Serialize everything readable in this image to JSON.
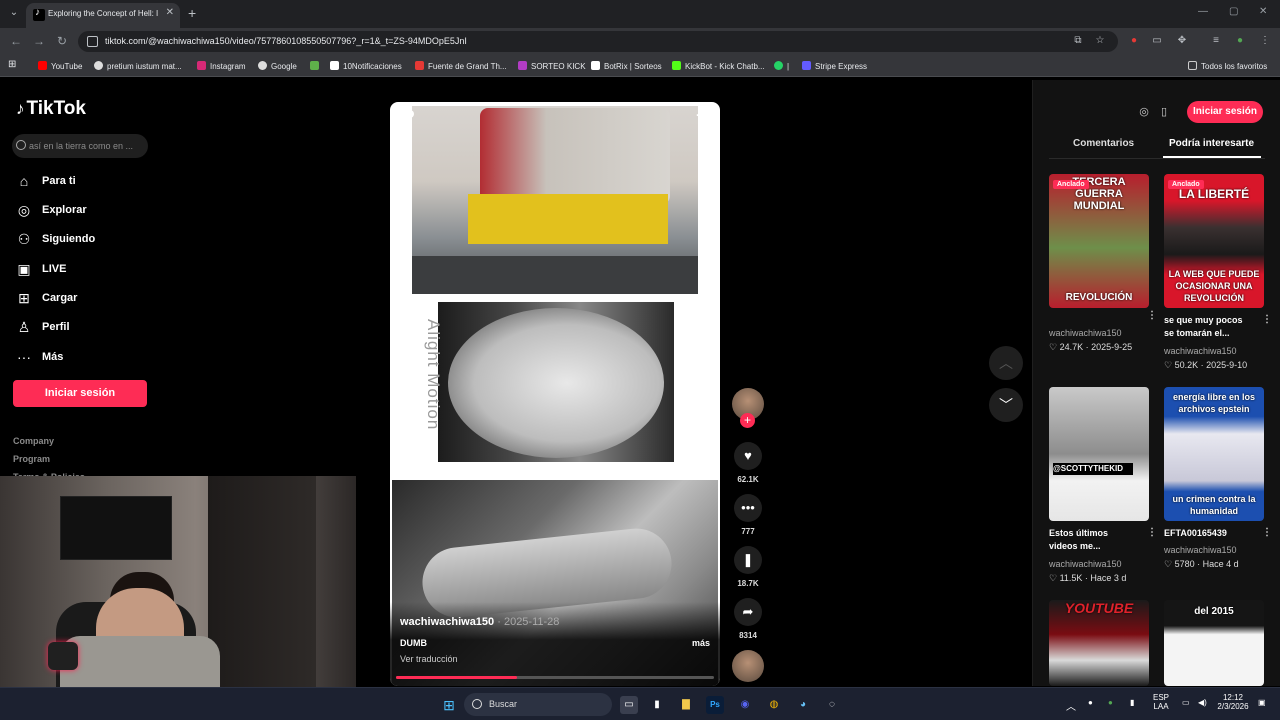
{
  "browser": {
    "tab_title": "Exploring the Concept of Hell: I",
    "url": "tiktok.com/@wachiwachiwa150/video/7577860108550507796?_r=1&_t=ZS-94MDOpE5JnI",
    "bookmarks": [
      {
        "label": "YouTube",
        "color": "#ff0000"
      },
      {
        "label": "pretium iustum mat...",
        "color": "#dddddd"
      },
      {
        "label": "Instagram",
        "color": "#d62976"
      },
      {
        "label": "Google",
        "color": "#dddddd"
      },
      {
        "label": "",
        "color": "#5fb04a"
      },
      {
        "label": "10Notificaciones",
        "color": "#ffffff"
      },
      {
        "label": "Fuente de Grand Th...",
        "color": "#e53935"
      },
      {
        "label": "SORTEO KICK",
        "color": "#b23cc4"
      },
      {
        "label": "BotRix | Sorteos",
        "color": "#ffffff"
      },
      {
        "label": "KickBot - Kick Chatb...",
        "color": "#53fc18"
      },
      {
        "label": "|",
        "color": "#25d366"
      },
      {
        "label": "Stripe Express",
        "color": "#635bff"
      }
    ],
    "all_favorites": "Todos los favoritos"
  },
  "sidebar": {
    "logo": "TikTok",
    "search_placeholder": "así en la tierra como en ...",
    "nav": [
      {
        "label": "Para ti",
        "icon": "home-icon"
      },
      {
        "label": "Explorar",
        "icon": "compass-icon"
      },
      {
        "label": "Siguiendo",
        "icon": "following-icon"
      },
      {
        "label": "LIVE",
        "icon": "live-icon"
      },
      {
        "label": "Cargar",
        "icon": "upload-icon"
      },
      {
        "label": "Perfil",
        "icon": "profile-icon"
      },
      {
        "label": "Más",
        "icon": "more-icon"
      }
    ],
    "login": "Iniciar sesión",
    "footer": [
      "Company",
      "Program",
      "Terms & Policies"
    ]
  },
  "video": {
    "watermark": "Alight Motion",
    "author": "wachiwachiwa150",
    "date": "· 2025-11-28",
    "caption": "DUMB",
    "more": "más",
    "translate": "Ver traducción",
    "progress": 0.38,
    "likes": "62.1K",
    "comments": "777",
    "saves": "18.7K",
    "shares": "8314"
  },
  "right_panel": {
    "login": "Iniciar sesión",
    "tab_comments": "Comentarios",
    "tab_related": "Podría interesarte",
    "pinned_label": "Anclado",
    "cards": [
      {
        "top": "TERCERA GUERRA MUNDIAL",
        "bottom": "REVOLUCIÓN",
        "desc": "",
        "user": "wachiwachiwa150",
        "meta": "♡ 24.7K · 2025-9-25",
        "bg": "#b81e2d"
      },
      {
        "top": "LA LIBERTÉ",
        "bottom": "LA WEB QUE PUEDE OCASIONAR UNA REVOLUCIÓN",
        "desc": "se que muy pocos se tomarán el...",
        "user": "wachiwachiwa150",
        "meta": "♡ 50.2K · 2025-9-10",
        "bg": "#d8162a"
      },
      {
        "top": "",
        "bottom": "@SCOTTYTHEKID",
        "desc": "Estos últimos videos me...",
        "user": "wachiwachiwa150",
        "meta": "♡ 11.5K · Hace 3 d",
        "bg": "#9c9c9c"
      },
      {
        "top": "energía libre en los archivos epstein",
        "bottom": "un crimen contra la humanidad",
        "desc": "EFTA00165439",
        "user": "wachiwachiwa150",
        "meta": "♡ 5780 · Hace 4 d",
        "bg": "#1c4fb0"
      },
      {
        "top": "YOUTUBE",
        "bottom": "",
        "desc": "",
        "user": "",
        "meta": "",
        "bg": "#7a0c12"
      },
      {
        "top": "del 2015",
        "bottom": "",
        "desc": "",
        "user": "",
        "meta": "",
        "bg": "#f0f0f0"
      }
    ]
  },
  "taskbar": {
    "search": "Buscar",
    "lang": "ESP",
    "region": "LAA",
    "time": "12:12",
    "date": "2/3/2026"
  }
}
